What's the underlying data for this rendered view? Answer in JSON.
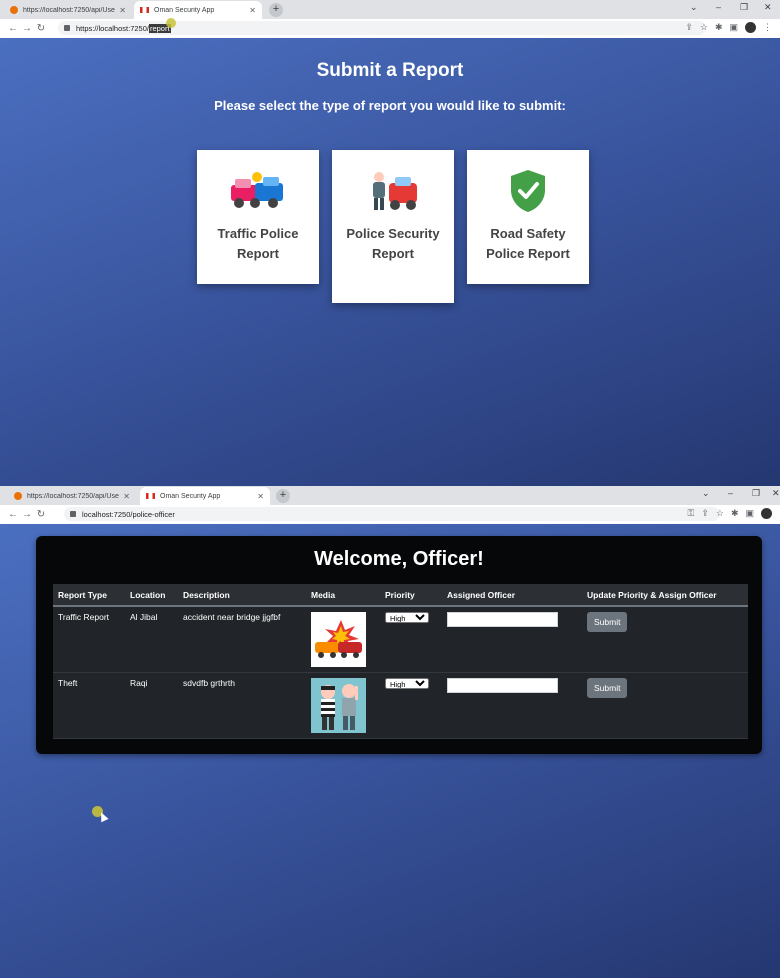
{
  "browser1": {
    "tabs": [
      {
        "label": "https://localhost:7250/api/User/..."
      },
      {
        "label": "Oman Security App"
      }
    ],
    "url_prefix": "https://localhost:7250/",
    "url_selected": "report",
    "new_tab": "+",
    "controls": {
      "minimize": "–",
      "restore": "❐",
      "close": "✕",
      "dropdown": "⌄"
    }
  },
  "report_page": {
    "title": "Submit a Report",
    "subtitle": "Please select the type of report you would like to submit:",
    "cards": [
      {
        "label": "Traffic Police Report",
        "icon": "car-crash-icon"
      },
      {
        "label": "Police Security Report",
        "icon": "police-officer-car-icon"
      },
      {
        "label": "Road Safety Police Report",
        "icon": "shield-check-icon"
      }
    ]
  },
  "browser2": {
    "tabs": [
      {
        "label": "https://localhost:7250/api/User/..."
      },
      {
        "label": "Oman Security App"
      }
    ],
    "url": "localhost:7250/police-officer",
    "new_tab": "+",
    "controls": {
      "minimize": "–",
      "restore": "❐",
      "close": "✕",
      "dropdown": "⌄"
    }
  },
  "officer_page": {
    "title": "Welcome, Officer!",
    "columns": [
      "Report Type",
      "Location",
      "Description",
      "Media",
      "Priority",
      "Assigned Officer",
      "Update Priority & Assign Officer"
    ],
    "rows": [
      {
        "type": "Traffic Report",
        "location": "Al Jibal",
        "description": "accident near bridge jjgfbf",
        "media": "car-crash-image",
        "priority": "High",
        "officer": "",
        "action": "Submit"
      },
      {
        "type": "Theft",
        "location": "Raqi",
        "description": "sdvdfb grthrth",
        "media": "thief-cartoon-image",
        "priority": "High",
        "officer": "",
        "action": "Submit"
      }
    ]
  },
  "colors": {
    "page_gradient_start": "#4b6fc0",
    "page_gradient_end": "#253771",
    "panel": "#060708",
    "table": "#212529",
    "button": "#6c757d",
    "shield": "#43a047"
  }
}
